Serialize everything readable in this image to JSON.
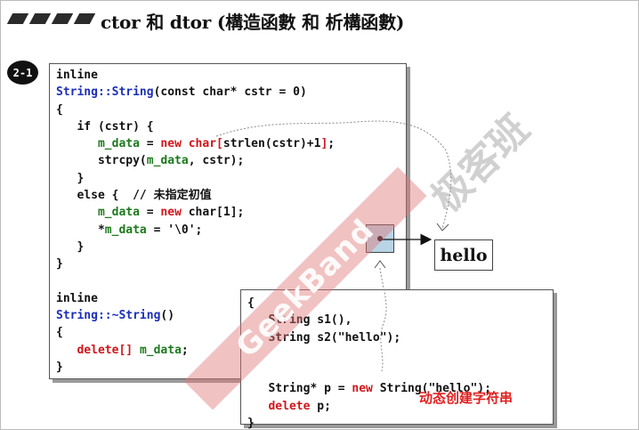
{
  "title": "ctor 和 dtor (構造函數 和 析構函數)",
  "badge": "2-1",
  "code_box_1": {
    "lines": [
      [
        {
          "t": "inline",
          "c": ""
        }
      ],
      [
        {
          "t": "String::String",
          "c": "bl"
        },
        {
          "t": "(const char* cstr = 0)",
          "c": ""
        }
      ],
      [
        {
          "t": "{",
          "c": ""
        }
      ],
      [
        {
          "t": "   if (cstr) {",
          "c": ""
        }
      ],
      [
        {
          "t": "      ",
          "c": ""
        },
        {
          "t": "m_data",
          "c": "gr"
        },
        {
          "t": " = ",
          "c": ""
        },
        {
          "t": "new char[",
          "c": "kw"
        },
        {
          "t": "strlen(cstr)+1",
          "c": ""
        },
        {
          "t": "]",
          "c": "kw"
        },
        {
          "t": ";",
          "c": ""
        }
      ],
      [
        {
          "t": "      strcpy(",
          "c": ""
        },
        {
          "t": "m_data",
          "c": "gr"
        },
        {
          "t": ", cstr);",
          "c": ""
        }
      ],
      [
        {
          "t": "   }",
          "c": ""
        }
      ],
      [
        {
          "t": "   else {  // 未指定初值",
          "c": ""
        }
      ],
      [
        {
          "t": "      ",
          "c": ""
        },
        {
          "t": "m_data",
          "c": "gr"
        },
        {
          "t": " = ",
          "c": ""
        },
        {
          "t": "new",
          "c": "kw"
        },
        {
          "t": " char[1];",
          "c": ""
        }
      ],
      [
        {
          "t": "      *",
          "c": ""
        },
        {
          "t": "m_data",
          "c": "gr"
        },
        {
          "t": " = '\\0';",
          "c": ""
        }
      ],
      [
        {
          "t": "   }",
          "c": ""
        }
      ],
      [
        {
          "t": "}",
          "c": ""
        }
      ],
      [
        {
          "t": "",
          "c": ""
        }
      ],
      [
        {
          "t": "inline",
          "c": ""
        }
      ],
      [
        {
          "t": "String::~String",
          "c": "bl"
        },
        {
          "t": "()",
          "c": ""
        }
      ],
      [
        {
          "t": "{",
          "c": ""
        }
      ],
      [
        {
          "t": "   ",
          "c": ""
        },
        {
          "t": "delete[]",
          "c": "kw"
        },
        {
          "t": " ",
          "c": ""
        },
        {
          "t": "m_data",
          "c": "gr"
        },
        {
          "t": ";",
          "c": ""
        }
      ],
      [
        {
          "t": "}",
          "c": ""
        }
      ]
    ]
  },
  "code_box_2": {
    "lines": [
      [
        {
          "t": "{",
          "c": ""
        }
      ],
      [
        {
          "t": "   String s1(),",
          "c": ""
        }
      ],
      [
        {
          "t": "   String s2(\"hello\");",
          "c": ""
        }
      ],
      [
        {
          "t": "",
          "c": ""
        }
      ],
      [
        {
          "t": "",
          "c": ""
        }
      ],
      [
        {
          "t": "   String* p = ",
          "c": ""
        },
        {
          "t": "new",
          "c": "kw"
        },
        {
          "t": " String(\"hello\");",
          "c": ""
        }
      ],
      [
        {
          "t": "   ",
          "c": ""
        },
        {
          "t": "delete",
          "c": "kw"
        },
        {
          "t": " p;",
          "c": ""
        }
      ],
      [
        {
          "t": "}",
          "c": ""
        }
      ]
    ],
    "note": "动态创建字符串"
  },
  "hello_box": "hello",
  "watermark": {
    "band_text": "GeekBand",
    "cn_text": "极客班"
  },
  "colors": {
    "keyword": "#d0161b",
    "class_name": "#1b2fb8",
    "member": "#1d7a1d",
    "note": "#e0201f",
    "pointer_fill": "#b8d4e6"
  }
}
